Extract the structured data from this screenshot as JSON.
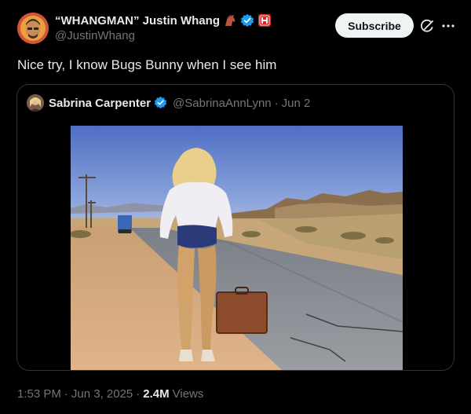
{
  "author": {
    "display_name": "“WHANGMAN” Justin Whang",
    "handle": "@JustinWhang",
    "avatar_icon": "avatar-illustration",
    "emoji_1": "horse-icon",
    "emoji_2": "red-h-badge-icon",
    "verified_color": "#1d9bf0"
  },
  "actions": {
    "subscribe_label": "Subscribe",
    "grok_icon": "grok-icon",
    "more_icon": "more-dots-icon"
  },
  "tweet": {
    "text": "Nice try, I know Bugs Bunny when I see him"
  },
  "quote": {
    "display_name": "Sabrina Carpenter",
    "handle": "@SabrinaAnnLynn",
    "separator": "·",
    "date": "Jun 2"
  },
  "footer": {
    "time": "1:53 PM",
    "separator": "·",
    "date": "Jun 3, 2025",
    "separator2": "·",
    "views_count": "2.4M",
    "views_label": "Views"
  },
  "colors": {
    "background": "#000000",
    "text": "#e7e9ea",
    "muted": "#71767b",
    "border": "#2f3336",
    "verified": "#1d9bf0"
  }
}
